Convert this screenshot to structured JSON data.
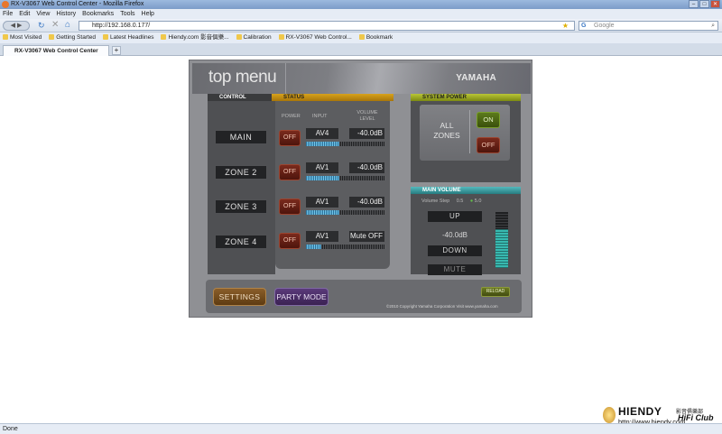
{
  "window": {
    "title": "RX-V3067 Web Control Center - Mozilla Firefox"
  },
  "menu": [
    "File",
    "Edit",
    "View",
    "History",
    "Bookmarks",
    "Tools",
    "Help"
  ],
  "nav": {
    "url": "http://192.168.0.177/",
    "search_placeholder": "Google",
    "search_engine_label": "G"
  },
  "bookmarks": [
    "Most Visited",
    "Getting Started",
    "Latest Headlines",
    "Hiendy.com 影音俱樂...",
    "Calibration",
    "RX-V3067 Web Control...",
    "Bookmark"
  ],
  "tab": {
    "label": "RX-V3067 Web Control Center",
    "new_tab": "+"
  },
  "status": "Done",
  "panel": {
    "title": "top menu",
    "brand": "YAMAHA",
    "control_header": "CONTROL",
    "status_header": "STATUS",
    "col_power": "POWER",
    "col_input": "INPUT",
    "col_volume": "VOLUME LEVEL",
    "zones": [
      {
        "name": "MAIN",
        "power": "OFF",
        "input": "AV4",
        "volume": "-40.0dB",
        "meter": 0.42
      },
      {
        "name": "ZONE 2",
        "power": "OFF",
        "input": "AV1",
        "volume": "-40.0dB",
        "meter": 0.42
      },
      {
        "name": "ZONE 3",
        "power": "OFF",
        "input": "AV1",
        "volume": "-40.0dB",
        "meter": 0.42
      },
      {
        "name": "ZONE 4",
        "power": "OFF",
        "input": "AV1",
        "volume": "Mute OFF",
        "meter": 0.2
      }
    ],
    "system_power": {
      "header": "SYSTEM POWER",
      "label_line1": "ALL",
      "label_line2": "ZONES",
      "on": "ON",
      "off": "OFF"
    },
    "main_volume": {
      "header": "MAIN VOLUME",
      "step_label": "Volume Step",
      "step_value": "0.5",
      "step_alt": "5.0",
      "up": "UP",
      "level": "-40.0dB",
      "down": "DOWN",
      "mute": "MUTE",
      "bar_level": 0.7
    },
    "settings": "SETTINGS",
    "party_mode": "PARTY MODE",
    "reload": "RELOAD",
    "copyright": "©2010 Copyright Yamaha Corporation Visit www.yamaha.com"
  },
  "watermark": {
    "name": "HIENDY",
    "cn": "影音俱樂部",
    "club": "HiFi Club",
    "url": "http://www.hiendy.com"
  }
}
